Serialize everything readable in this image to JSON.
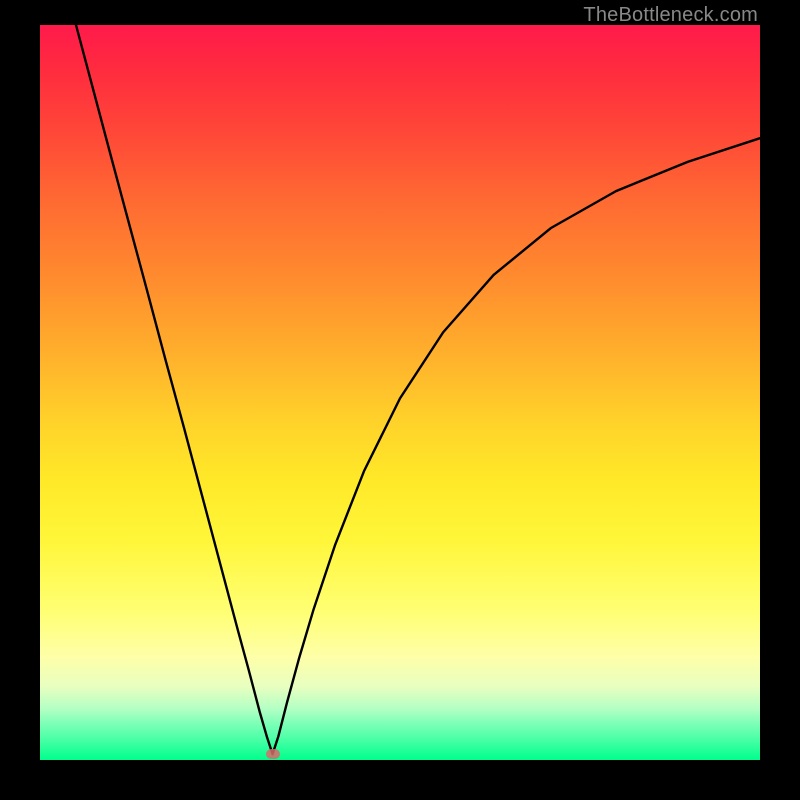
{
  "watermark": "TheBottleneck.com",
  "marker": {
    "x_frac": 0.323,
    "y_frac": 0.992
  },
  "colors": {
    "frame": "#000000",
    "curve": "#000000",
    "marker": "#d86a6a",
    "gradient_top": "#ff1a4b",
    "gradient_bottom": "#00ff8c"
  },
  "chart_data": {
    "type": "line",
    "title": "",
    "xlabel": "",
    "ylabel": "",
    "xlim": [
      0,
      1
    ],
    "ylim": [
      0,
      1
    ],
    "series": [
      {
        "name": "curve",
        "x": [
          0.05,
          0.075,
          0.1,
          0.125,
          0.15,
          0.175,
          0.2,
          0.225,
          0.25,
          0.275,
          0.29,
          0.305,
          0.315,
          0.323,
          0.331,
          0.343,
          0.36,
          0.38,
          0.41,
          0.45,
          0.5,
          0.56,
          0.63,
          0.71,
          0.8,
          0.9,
          1.0
        ],
        "y": [
          1.0,
          0.908,
          0.816,
          0.725,
          0.634,
          0.542,
          0.452,
          0.36,
          0.268,
          0.176,
          0.122,
          0.066,
          0.032,
          0.008,
          0.032,
          0.078,
          0.139,
          0.205,
          0.293,
          0.393,
          0.492,
          0.582,
          0.66,
          0.724,
          0.774,
          0.814,
          0.846
        ]
      }
    ],
    "marker_point": {
      "x": 0.323,
      "y": 0.008
    },
    "notes": "Axes are unlabeled; values are normalized fractions of the plot area. y=0 at bottom, x=0 at left. Left branch is roughly linear descending; right branch is concave-increasing approaching ~0.85."
  }
}
